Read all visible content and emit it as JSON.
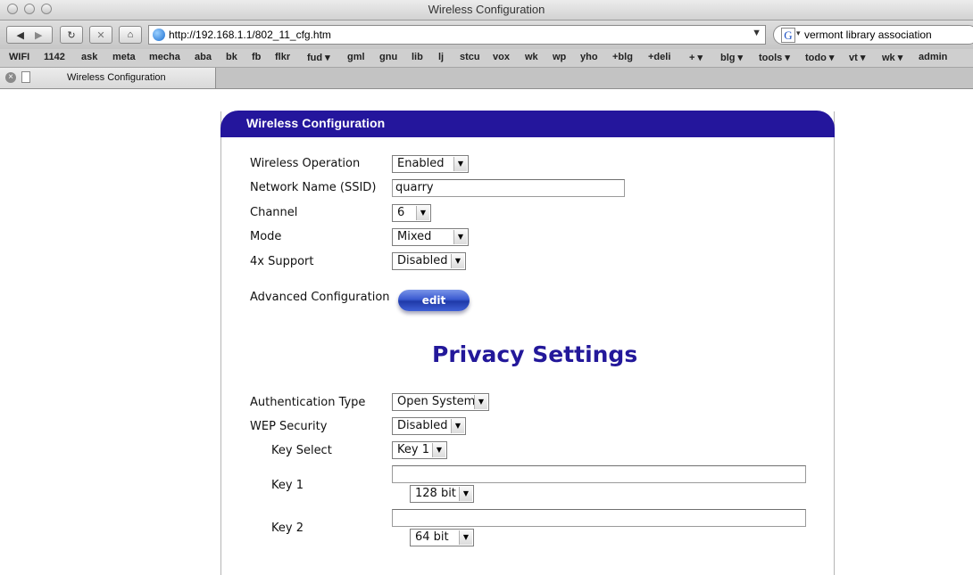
{
  "window": {
    "title": "Wireless Configuration"
  },
  "toolbar": {
    "url": "http://192.168.1.1/802_11_cfg.htm",
    "search_query": "vermont library association"
  },
  "bookmarks": [
    "WIFI",
    "1142",
    "ask",
    "meta",
    "mecha",
    "aba",
    "bk",
    "fb",
    "flkr",
    "fud ▾",
    "gml",
    "gnu",
    "lib",
    "lj",
    "stcu",
    "vox",
    "wk",
    "wp",
    "yho",
    "+blg",
    "+deli",
    "+ ▾",
    "blg ▾",
    "tools ▾",
    "todo ▾",
    "vt ▾",
    "wk ▾",
    "admin"
  ],
  "tab": {
    "label": "Wireless Configuration"
  },
  "panel": {
    "title": "Wireless Configuration",
    "fields": {
      "wireless_operation": {
        "label": "Wireless Operation",
        "value": "Enabled"
      },
      "ssid": {
        "label": "Network Name (SSID)",
        "value": "quarry"
      },
      "channel": {
        "label": "Channel",
        "value": "6"
      },
      "mode": {
        "label": "Mode",
        "value": "Mixed"
      },
      "support_4x": {
        "label": "4x Support",
        "value": "Disabled"
      }
    },
    "advanced": {
      "label": "Advanced Configuration",
      "button": "edit"
    },
    "privacy": {
      "title": "Privacy Settings",
      "auth_type": {
        "label": "Authentication Type",
        "value": "Open System"
      },
      "wep_security": {
        "label": "WEP Security",
        "value": "Disabled"
      },
      "key_select": {
        "label": "Key Select",
        "value": "Key 1"
      },
      "key1": {
        "label": "Key 1",
        "value": "",
        "bits": "128 bit"
      },
      "key2": {
        "label": "Key 2",
        "value": "",
        "bits": "64 bit"
      }
    }
  }
}
